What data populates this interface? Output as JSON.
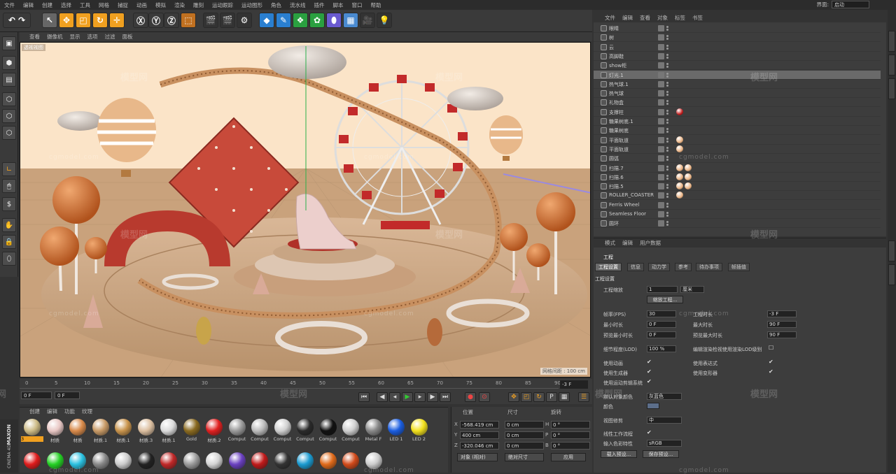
{
  "menubar": {
    "items": [
      "文件",
      "编辑",
      "创建",
      "选择",
      "工具",
      "网格",
      "捕捉",
      "动画",
      "模拟",
      "渲染",
      "雕刻",
      "运动跟踪",
      "运动图形",
      "角色",
      "流水线",
      "插件",
      "脚本",
      "窗口",
      "帮助"
    ],
    "ui_label": "界面:",
    "ui_value": "启动"
  },
  "viewport": {
    "menu": [
      "查看",
      "摄像机",
      "显示",
      "选项",
      "过滤",
      "面板"
    ],
    "label": "透视视图",
    "grid_label": "网格间距 : 100 cm"
  },
  "timeline": {
    "ticks": [
      "0",
      "5",
      "10",
      "15",
      "20",
      "25",
      "30",
      "35",
      "40",
      "45",
      "50",
      "55",
      "60",
      "65",
      "70",
      "75",
      "80",
      "85",
      "90"
    ],
    "frame_indicator": "-3 F",
    "start": "0 F",
    "start2": "0 F",
    "end1": "90 F",
    "end2": "90 F"
  },
  "materials": {
    "menu": [
      "创建",
      "编辑",
      "功能",
      "纹理"
    ],
    "row1": [
      {
        "name": "3",
        "color": "#cdbb86"
      },
      {
        "name": "材质",
        "color": "#e8c7c4"
      },
      {
        "name": "材质",
        "color": "#d88a4a"
      },
      {
        "name": "材质.1",
        "color": "#c89a66"
      },
      {
        "name": "材质.1",
        "color": "#c9944c"
      },
      {
        "name": "材质.3",
        "color": "#dcbfa0"
      },
      {
        "name": "材质.1",
        "color": "#dcdcdc"
      },
      {
        "name": "Gold",
        "color": "#8a6a20"
      },
      {
        "name": "材质.2",
        "color": "#e02020"
      },
      {
        "name": "Comput",
        "color": "#9a9a9a"
      },
      {
        "name": "Comput",
        "color": "#bcbcbc"
      },
      {
        "name": "Comput",
        "color": "#d0d0d0"
      },
      {
        "name": "Comput",
        "color": "#2a2a2a"
      },
      {
        "name": "Comput",
        "color": "#111111"
      },
      {
        "name": "Comput",
        "color": "#cfcfcf"
      },
      {
        "name": "Metal F",
        "color": "#888888"
      },
      {
        "name": "LED 1",
        "color": "#1a5de0"
      },
      {
        "name": "LED 2",
        "color": "#f2e01c"
      }
    ],
    "row2": [
      "#e01c1c",
      "#24d024",
      "#2ac0e0",
      "#888888",
      "#cccccc",
      "#222222",
      "#c02828",
      "#9a9a9a",
      "#d4d4d4",
      "#6a40c0",
      "#c01a1a",
      "#333333",
      "#1a9ad0",
      "#e06a1a",
      "#d24a1a",
      "#cccccc"
    ]
  },
  "coords": {
    "head_pos": "位置",
    "head_size": "尺寸",
    "head_rot": "旋转",
    "rows": [
      {
        "axis": "X",
        "pos": "-568.419 cm",
        "size": "0 cm",
        "rot_axis": "H",
        "rot": "0 °"
      },
      {
        "axis": "Y",
        "pos": "400 cm",
        "size": "0 cm",
        "rot_axis": "P",
        "rot": "0 °"
      },
      {
        "axis": "Z",
        "pos": "-320.046 cm",
        "size": "0 cm",
        "rot_axis": "B",
        "rot": "0 °"
      }
    ],
    "mode": "对象 (相对)",
    "size_mode": "绝对尺寸",
    "apply": "应用"
  },
  "objects": {
    "menu": [
      "文件",
      "编辑",
      "查看",
      "对象",
      "标签",
      "书签"
    ],
    "items": [
      {
        "name": "眼睛"
      },
      {
        "name": "树"
      },
      {
        "name": "云"
      },
      {
        "name": "高脚鞋"
      },
      {
        "name": "show柜"
      },
      {
        "name": "灯光.1"
      },
      {
        "name": "热气球.1"
      },
      {
        "name": "热气球"
      },
      {
        "name": "礼物盒"
      },
      {
        "name": "支撑柱"
      },
      {
        "name": "糖果树底.1"
      },
      {
        "name": "糖果树底"
      },
      {
        "name": "平面轨道"
      },
      {
        "name": "平面轨道"
      },
      {
        "name": "圆弧"
      },
      {
        "name": "扫描.7"
      },
      {
        "name": "扫描.6"
      },
      {
        "name": "扫描.5"
      },
      {
        "name": "ROLLER_COASTER"
      },
      {
        "name": "Ferris Wheel"
      },
      {
        "name": "Seamless Floor"
      },
      {
        "name": "圆环"
      }
    ]
  },
  "attributes": {
    "menu": [
      "模式",
      "编辑",
      "用户数据"
    ],
    "title": "工程",
    "tabs": [
      "工程设置",
      "信息",
      "动力学",
      "参考",
      "待办事项",
      "帧插值"
    ],
    "section": "工程设置",
    "scale_label": "工程缩放",
    "scale_value": "1",
    "scale_unit": "厘米",
    "scale_btn": "缩放工程...",
    "fps_label": "帧率(FPS)",
    "fps": "30",
    "min_label": "最小时长",
    "min": "0 F",
    "preview_min_label": "预览最小时长",
    "preview_min": "0 F",
    "proj_time_label": "工程时长",
    "proj_time": "-3 F",
    "max_label": "最大时长",
    "max": "90 F",
    "preview_max_label": "预览最大时长",
    "preview_max": "90 F",
    "lod_label": "细节程度(LOD)",
    "lod": "100 %",
    "lod_render_label": "编辑渲染检视使用渲染LOD级别",
    "use_anim": "使用动画",
    "use_gen": "使用生成器",
    "use_motion": "使用运动剪辑系统",
    "use_expr": "使用表达式",
    "use_deform": "使用变形器",
    "default_color_label": "默认对象颜色",
    "default_color": "灰蓝色",
    "color_label": "颜色",
    "view_clip_label": "视图修剪",
    "view_clip": "中",
    "linear_label": "线性工作流程",
    "input_color_label": "输入色彩特性",
    "input_color": "sRGB",
    "load_btn": "载入预设...",
    "save_btn": "保存预设..."
  },
  "watermark": {
    "brand": "模型网",
    "site": "cgmodel.com"
  },
  "brand": {
    "maxon": "MAXON",
    "c4d": "CINEMA 4D"
  }
}
